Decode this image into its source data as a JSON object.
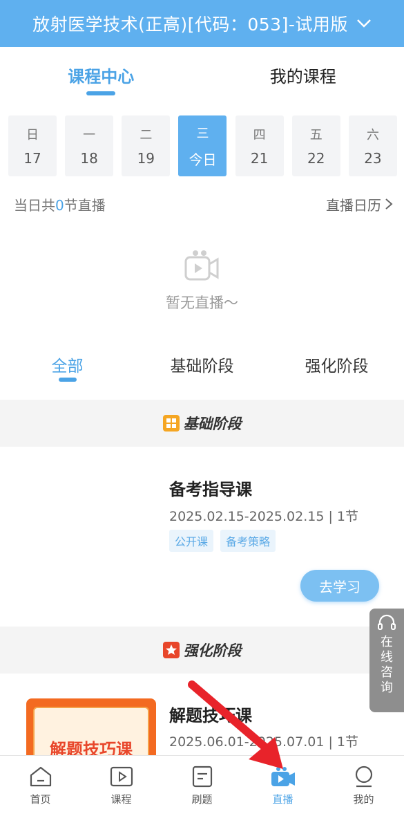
{
  "header": {
    "title": "放射医学技术(正高)[代码：053]-试用版"
  },
  "top_tabs": [
    {
      "label": "课程中心",
      "active": true
    },
    {
      "label": "我的课程",
      "active": false
    }
  ],
  "week": [
    {
      "name": "日",
      "num": "17"
    },
    {
      "name": "一",
      "num": "18"
    },
    {
      "name": "二",
      "num": "19"
    },
    {
      "name": "三",
      "num": "今日",
      "active": true
    },
    {
      "name": "四",
      "num": "21"
    },
    {
      "name": "五",
      "num": "22"
    },
    {
      "name": "六",
      "num": "23"
    }
  ],
  "live_count": {
    "prefix": "当日共",
    "count": "0",
    "suffix": "节直播"
  },
  "calendar_link": "直播日历",
  "empty": {
    "text": "暂无直播～"
  },
  "stage_tabs": [
    {
      "label": "全部",
      "active": true
    },
    {
      "label": "基础阶段",
      "active": false
    },
    {
      "label": "强化阶段",
      "active": false
    }
  ],
  "sections": {
    "basic": {
      "label": "基础阶段",
      "icon": "grid-icon",
      "color": "#f5a623"
    },
    "intensive": {
      "label": "强化阶段",
      "icon": "star-icon",
      "color": "#e8462a"
    }
  },
  "courses": [
    {
      "title": "备考指导课",
      "meta": "2025.02.15-2025.02.15  |  1节",
      "tags": [
        "公开课",
        "备考策略"
      ],
      "button": "去学习"
    },
    {
      "title": "解题技巧课",
      "meta": "2025.06.01-2025.07.01  |  1节",
      "thumb_text": "解题技巧课"
    }
  ],
  "consult": {
    "label": "在线咨询"
  },
  "bottom_nav": [
    {
      "label": "首页",
      "icon": "home-icon"
    },
    {
      "label": "课程",
      "icon": "play-icon"
    },
    {
      "label": "刷题",
      "icon": "document-icon"
    },
    {
      "label": "直播",
      "icon": "camera-icon",
      "active": true
    },
    {
      "label": "我的",
      "icon": "user-icon"
    }
  ],
  "colors": {
    "brand": "#5fb0ef",
    "accent": "#4ba3e6",
    "arrow": "#e8232a"
  }
}
